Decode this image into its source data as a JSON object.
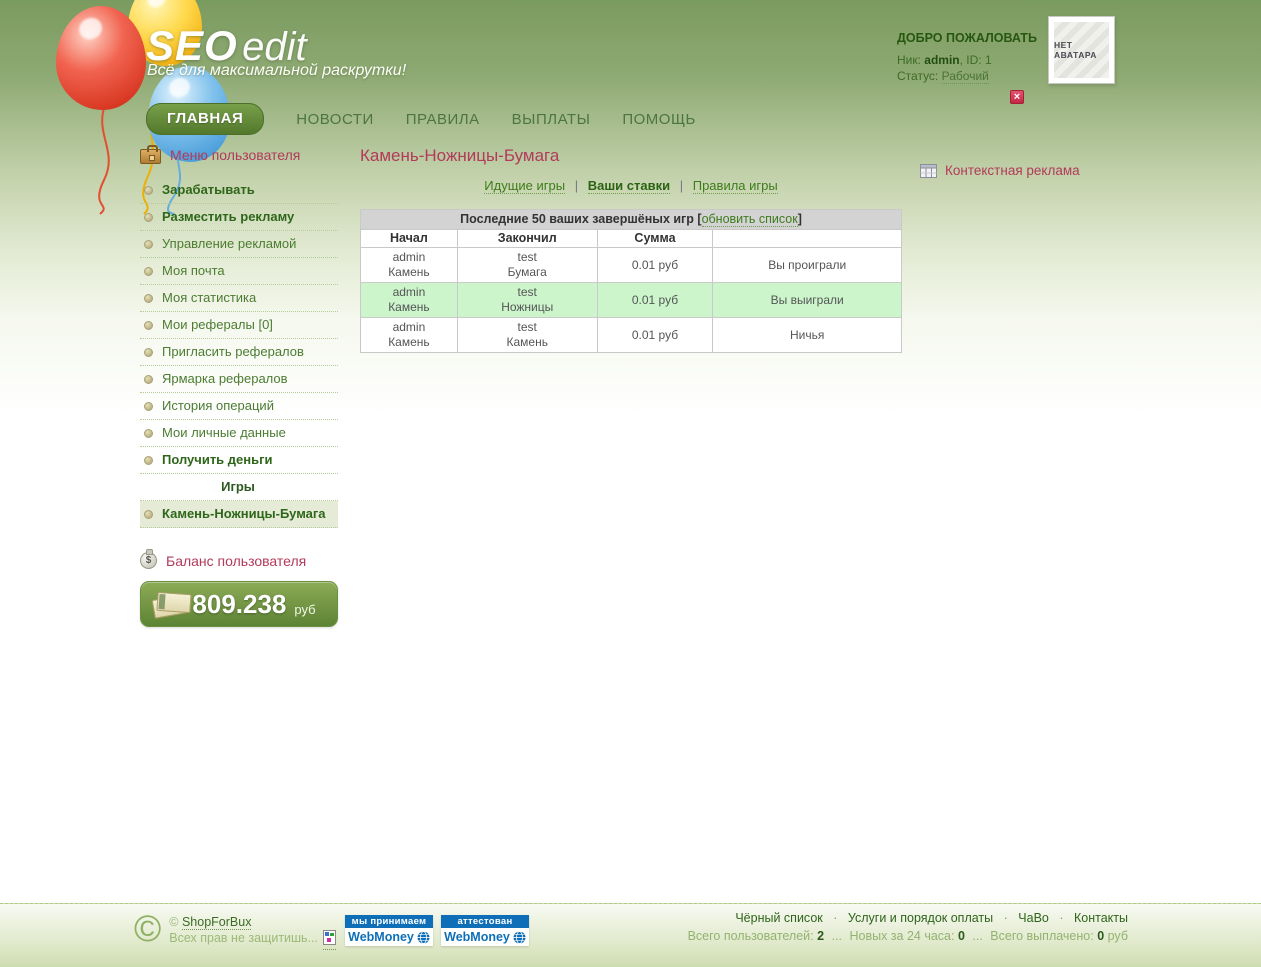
{
  "header": {
    "logo": {
      "seo": "SEO",
      "edit": "edit"
    },
    "tagline": "Всё для максимальной раскрутки!",
    "nav": [
      {
        "label": "ГЛАВНАЯ",
        "active": true
      },
      {
        "label": "НОВОСТИ",
        "active": false
      },
      {
        "label": "ПРАВИЛА",
        "active": false
      },
      {
        "label": "ВЫПЛАТЫ",
        "active": false
      },
      {
        "label": "ПОМОЩЬ",
        "active": false
      }
    ],
    "welcome": {
      "title": "ДОБРО ПОЖАЛОВАТЬ",
      "nick_label": "Ник:",
      "nick": "admin",
      "id_label": ", ID:",
      "id": "1",
      "status_label": "Статус:",
      "status": "Рабочий"
    },
    "avatar_text": "НЕТ АВАТАРА",
    "close_icon_glyph": "×"
  },
  "sidebar": {
    "menu_title": "Меню пользователя",
    "items": [
      {
        "label": "Зарабатывать",
        "bold": true
      },
      {
        "label": "Разместить рекламу",
        "bold": true
      },
      {
        "label": "Управление рекламой",
        "bold": false
      },
      {
        "label": "Моя почта",
        "bold": false
      },
      {
        "label": "Моя статистика",
        "bold": false
      },
      {
        "label": "Мои рефералы [0]",
        "bold": false
      },
      {
        "label": "Пригласить рефералов",
        "bold": false
      },
      {
        "label": "Ярмарка рефералов",
        "bold": false
      },
      {
        "label": "История операций",
        "bold": false
      },
      {
        "label": "Мои личные данные",
        "bold": false
      },
      {
        "label": "Получить деньги",
        "bold": true
      },
      {
        "label": "Камень-Ножницы-Бумага",
        "bold": true,
        "active": true
      }
    ],
    "games_header": "Игры",
    "balance_title": "Баланс пользователя",
    "balance": {
      "amount": "809.238",
      "currency": "руб"
    }
  },
  "main": {
    "title": "Камень-Ножницы-Бумага",
    "tab_separator": "|",
    "tabs": [
      {
        "label": "Идущие игры",
        "active": false
      },
      {
        "label": "Ваши ставки",
        "active": true
      },
      {
        "label": "Правила игры",
        "active": false
      }
    ],
    "table": {
      "caption": "Последние 50 ваших завершёных игр",
      "bracket_open": "[",
      "refresh_label": "обновить список",
      "bracket_close": "]",
      "columns": [
        "Начал",
        "Закончил",
        "Сумма",
        ""
      ],
      "rows": [
        {
          "starter": "admin",
          "starter_move": "Камень",
          "finisher": "test",
          "finisher_move": "Бумага",
          "amount": "0.01 руб",
          "result": "Вы проиграли",
          "highlight": false
        },
        {
          "starter": "admin",
          "starter_move": "Камень",
          "finisher": "test",
          "finisher_move": "Ножницы",
          "amount": "0.01 руб",
          "result": "Вы выиграли",
          "highlight": true
        },
        {
          "starter": "admin",
          "starter_move": "Камень",
          "finisher": "test",
          "finisher_move": "Камень",
          "amount": "0.01 руб",
          "result": "Ничья",
          "highlight": false
        }
      ]
    },
    "context_ad_title": "Контекстная реклама"
  },
  "footer": {
    "copyright_symbol": "©",
    "copyright_prefix": "©",
    "site_link": "ShopForBux",
    "rights_note": "Всех прав не защитишь...",
    "badges": [
      {
        "top": "мы принимаем",
        "name": "WebMoney"
      },
      {
        "top": "аттестован",
        "name": "WebMoney"
      }
    ],
    "links": [
      "Чёрный список",
      "Услуги и порядок оплаты",
      "ЧаВо",
      "Контакты"
    ],
    "link_separator": "·",
    "stats_separator": "...",
    "stats": [
      {
        "label": "Всего пользователей:",
        "value": "2",
        "unit": ""
      },
      {
        "label": "Новых за 24 часа:",
        "value": "0",
        "unit": ""
      },
      {
        "label": "Всего выплачено:",
        "value": "0",
        "unit": "руб"
      }
    ]
  },
  "colors": {
    "accent_crimson": "#b23a5a",
    "link_green": "#3e7c1c",
    "header_green": "#7a9b5f",
    "highlight_row": "#ccf5cc",
    "balance_green": "#6f9444",
    "webmoney_blue": "#0e6fb8"
  }
}
